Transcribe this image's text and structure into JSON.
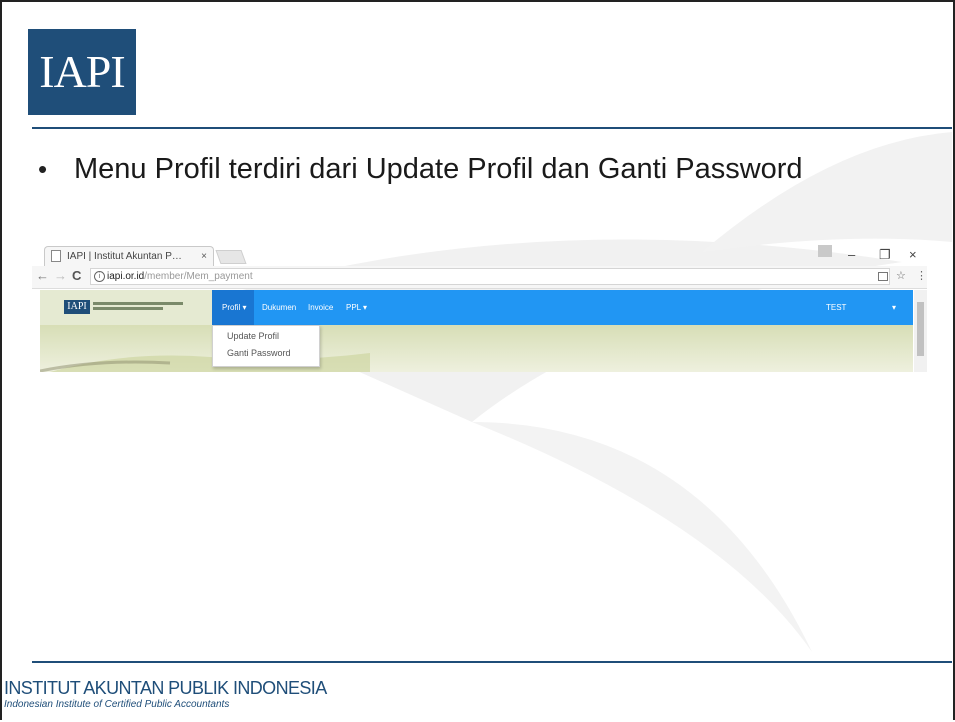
{
  "logo": {
    "text": "IAPI"
  },
  "bullet": {
    "symbol": "•",
    "text": "Menu Profil terdiri dari Update Profil dan Ganti Password"
  },
  "browser": {
    "tab_title": "IAPI | Institut Akuntan P…",
    "tab_close": "×",
    "url_host": "iapi.or.id",
    "url_path": "/member/Mem_payment",
    "nav_back": "←",
    "nav_forward": "→",
    "nav_reload": "C",
    "info": "i",
    "star": "☆",
    "menu_dots": "⋮",
    "window_minimize": "–",
    "window_maximize": "❐",
    "window_close": "×"
  },
  "site": {
    "logo_text": "IAPI",
    "nav": {
      "items": [
        "Profil ▾",
        "Dukumen",
        "Invoice",
        "PPL ▾"
      ],
      "user": "TEST",
      "user_caret": "▾"
    },
    "dropdown": [
      "Update Profil",
      "Ganti Password"
    ]
  },
  "footer": {
    "title": "INSTITUT AKUNTAN PUBLIK INDONESIA",
    "subtitle": "Indonesian Institute of Certified Public Accountants"
  },
  "colors": {
    "brand": "#1f4e79",
    "navbar": "#2196f3",
    "navbar_active": "#1976d2"
  }
}
